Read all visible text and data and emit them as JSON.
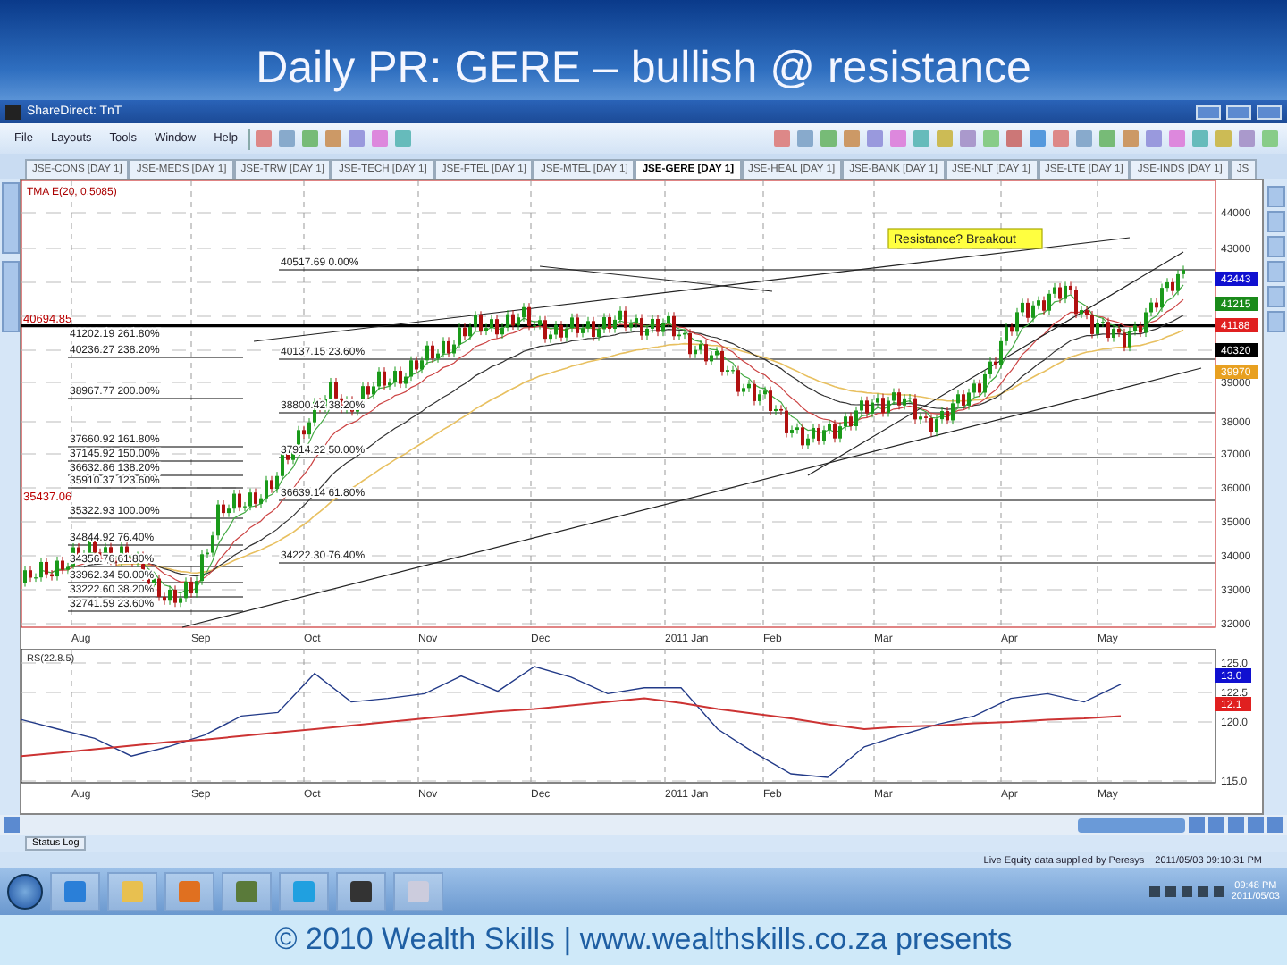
{
  "slide": {
    "title": "Daily PR: GERE – bullish @ resistance",
    "footer": "© 2010 Wealth Skills | www.wealthskills.co.za presents"
  },
  "window": {
    "title": "ShareDirect: TnT",
    "menu": [
      "File",
      "Layouts",
      "Tools",
      "Window",
      "Help"
    ],
    "tabs": [
      {
        "label": "JSE-CONS [DAY 1]",
        "selected": false
      },
      {
        "label": "JSE-MEDS [DAY 1]",
        "selected": false
      },
      {
        "label": "JSE-TRW [DAY 1]",
        "selected": false
      },
      {
        "label": "JSE-TECH [DAY 1]",
        "selected": false
      },
      {
        "label": "JSE-FTEL [DAY 1]",
        "selected": false
      },
      {
        "label": "JSE-MTEL [DAY 1]",
        "selected": false
      },
      {
        "label": "JSE-GERE [DAY 1]",
        "selected": true
      },
      {
        "label": "JSE-HEAL [DAY 1]",
        "selected": false
      },
      {
        "label": "JSE-BANK [DAY 1]",
        "selected": false
      },
      {
        "label": "JSE-NLT [DAY 1]",
        "selected": false
      },
      {
        "label": "JSE-LTE [DAY 1]",
        "selected": false
      },
      {
        "label": "JSE-INDS [DAY 1]",
        "selected": false
      },
      {
        "label": "JS",
        "selected": false
      }
    ],
    "price_pane": {
      "indicator": "TMA E(20, 0.5085)",
      "resistance_label": "40694.85",
      "low_label": "35437.06",
      "note": "Resistance? Breakout",
      "fib_left": [
        "41202.19 261.80%",
        "40236.27 238.20%",
        "38967.77 200.00%",
        "37660.92 161.80%",
        "37145.92 150.00%",
        "36632.86 138.20%",
        "35910.37 123.60%",
        "35322.93 100.00%",
        "34844.92 76.40%",
        "34356.76 61.80%",
        "33962.34 50.00%",
        "33222.60 38.20%",
        "32741.59 23.60%"
      ],
      "fib_mid": [
        "40517.69 0.00%",
        "40137.15 23.60%",
        "38800.42 38.20%",
        "37914.22 50.00%",
        "36639.14 61.80%",
        "34222.30 76.40%"
      ],
      "y_labels": [
        "44000",
        "43000",
        "39000",
        "38000",
        "37000",
        "36000",
        "35000",
        "34000",
        "33000",
        "32000"
      ],
      "badges": [
        {
          "text": "42443",
          "color": "#1010d0"
        },
        {
          "text": "41215",
          "color": "#1a8a1a"
        },
        {
          "text": "41188",
          "color": "#e02020"
        },
        {
          "text": "40320",
          "color": "#000000"
        },
        {
          "text": "39970",
          "color": "#e8a020"
        }
      ],
      "x_labels": [
        "Aug",
        "Sep",
        "Oct",
        "Nov",
        "Dec",
        "2011 Jan",
        "Feb",
        "Mar",
        "Apr",
        "May"
      ]
    },
    "rsi_pane": {
      "indicator": "RS(22.8.5)",
      "chart_data": {
        "type": "line",
        "grid": true,
        "ylim": [
          115,
          126.1
        ],
        "yticks": [
          {
            "value": 125,
            "label": "125.0"
          },
          {
            "value": 122.5,
            "label": "122.5"
          },
          {
            "value": 120,
            "label": "120.0"
          },
          {
            "value": 115,
            "label": "115.0"
          }
        ],
        "series": [
          {
            "color": "#223a88",
            "values": [
              120.2,
              119.4,
              118.6,
              117.1,
              117.9,
              118.9,
              120.5,
              120.8,
              124.1,
              121.7,
              122.0,
              122.4,
              123.9,
              122.6,
              124.7,
              123.8,
              122.4,
              122.9,
              122.9,
              119.4,
              117.4,
              115.6,
              115.3,
              117.9,
              118.9,
              119.8,
              120.5,
              122.0,
              122.4,
              121.7,
              123.2
            ]
          },
          {
            "color": "#cc3333",
            "values": [
              117.1,
              117.4,
              117.7,
              118.0,
              118.3,
              118.5,
              118.8,
              119.1,
              119.4,
              119.7,
              120.0,
              120.3,
              120.6,
              120.9,
              121.1,
              121.4,
              121.7,
              122.0,
              121.6,
              121.1,
              120.7,
              120.3,
              119.8,
              119.4,
              119.6,
              119.7,
              119.9,
              120.0,
              120.2,
              120.3,
              120.5
            ]
          }
        ]
      },
      "badges": [
        {
          "text": "13.0",
          "color": "#1010d0"
        },
        {
          "text": "12.1",
          "color": "#e02020"
        }
      ],
      "x_labels": [
        "Aug",
        "Sep",
        "Oct",
        "Nov",
        "Dec",
        "2011 Jan",
        "Feb",
        "Mar",
        "Apr",
        "May"
      ]
    },
    "status_tab": "Status Log",
    "status": [
      "Live Equity data supplied by Peresys",
      "2011/05/03 09:10:31 PM"
    ],
    "clock": [
      "09:48 PM",
      "2011/05/03"
    ]
  }
}
